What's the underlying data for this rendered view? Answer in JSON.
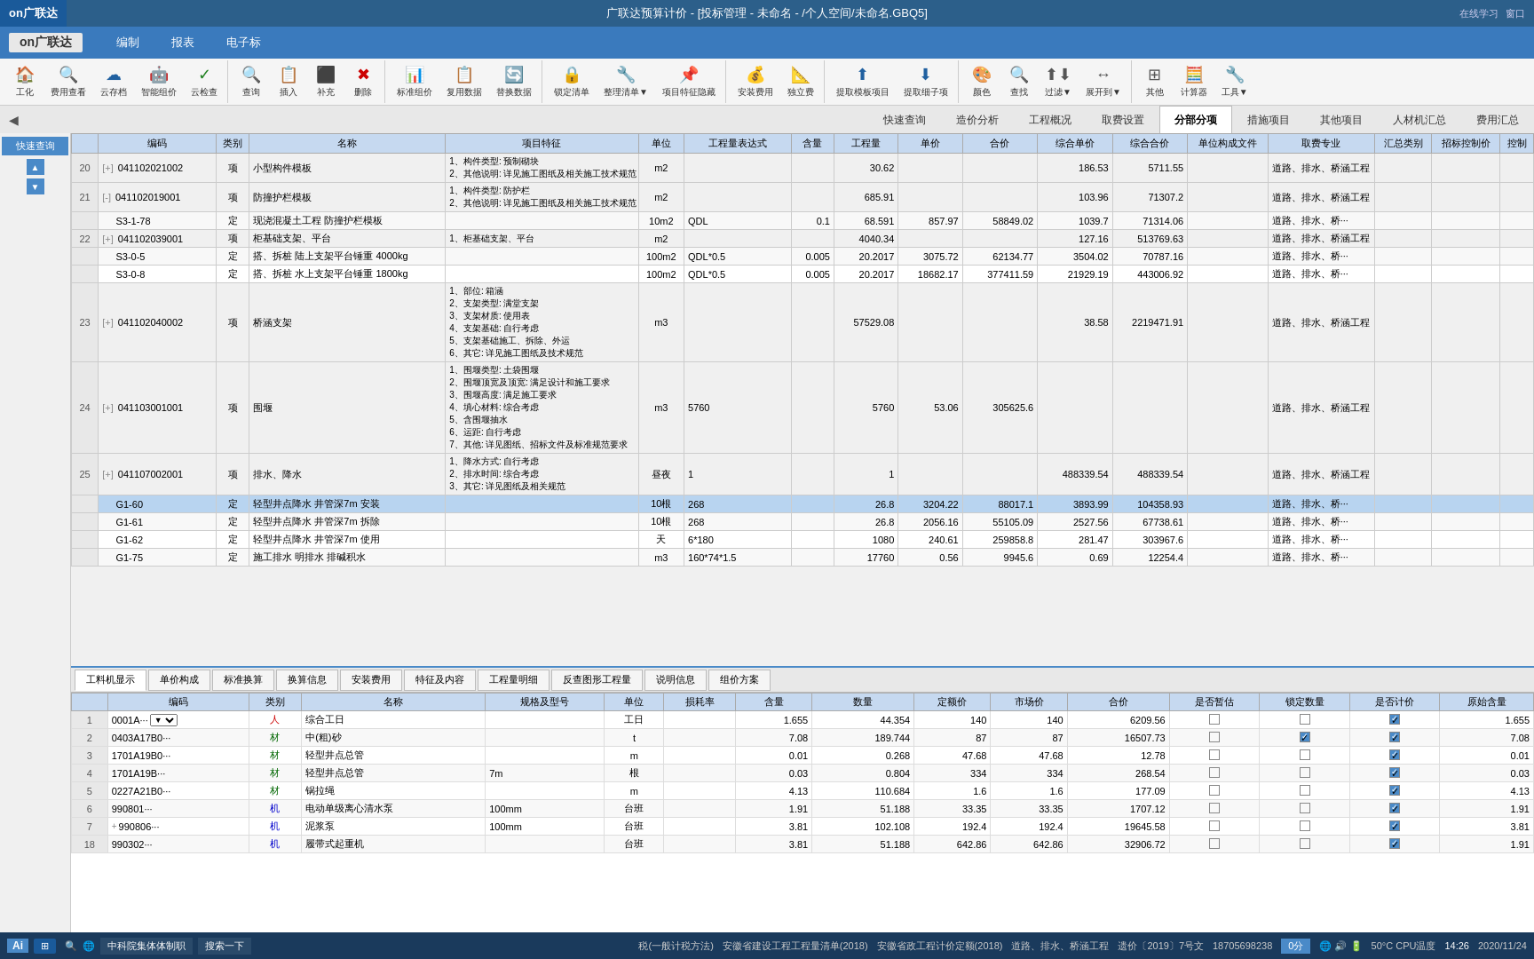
{
  "window": {
    "title": "广联达预算计价 - [投标管理 - 未命名 - /个人空间/未命名.GBQ5]"
  },
  "menubar": {
    "logo": "on广联达",
    "items": [
      "编制",
      "报表",
      "电子标"
    ],
    "right": [
      "在线学习",
      "窗口"
    ]
  },
  "toolbar": {
    "groups": [
      {
        "buttons": [
          {
            "icon": "🏠",
            "label": "工化"
          },
          {
            "icon": "🔍",
            "label": "费用查看"
          },
          {
            "icon": "☁",
            "label": "云存档"
          },
          {
            "icon": "🤖",
            "label": "智能组价"
          },
          {
            "icon": "✓",
            "label": "云检查"
          }
        ]
      },
      {
        "buttons": [
          {
            "icon": "🔍",
            "label": "查询"
          },
          {
            "icon": "📋",
            "label": "插入"
          },
          {
            "icon": "⬛",
            "label": "补充"
          },
          {
            "icon": "❌",
            "label": "删除"
          }
        ]
      },
      {
        "buttons": [
          {
            "icon": "📊",
            "label": "标准组价"
          },
          {
            "icon": "📋",
            "label": "复用数据"
          },
          {
            "icon": "🔄",
            "label": "替换数据"
          }
        ]
      },
      {
        "buttons": [
          {
            "icon": "🔒",
            "label": "锁定清单"
          },
          {
            "icon": "🔧",
            "label": "整理清单"
          },
          {
            "icon": "📌",
            "label": "项目特征隐藏"
          }
        ]
      },
      {
        "buttons": [
          {
            "icon": "💰",
            "label": "安装费用"
          },
          {
            "icon": "📐",
            "label": "独立费"
          }
        ]
      },
      {
        "buttons": [
          {
            "icon": "⬆",
            "label": "提取模板项目"
          },
          {
            "icon": "⬇",
            "label": "提取细子项"
          }
        ]
      },
      {
        "buttons": [
          {
            "icon": "🎨",
            "label": "颜色"
          },
          {
            "icon": "🔍",
            "label": "查找"
          },
          {
            "icon": "⬆⬇",
            "label": "过滤"
          },
          {
            "icon": "↔",
            "label": "展开到"
          }
        ]
      },
      {
        "buttons": [
          {
            "icon": "⊞",
            "label": "其他"
          },
          {
            "icon": "🧮",
            "label": "计算器"
          },
          {
            "icon": "🔧",
            "label": "工具"
          }
        ]
      }
    ]
  },
  "tabs": {
    "items": [
      "快速查询",
      "造价分析",
      "工程概况",
      "取费设置",
      "分部分项",
      "措施项目",
      "其他项目",
      "人材机汇总",
      "费用汇总"
    ],
    "active": "分部分项"
  },
  "table": {
    "headers": [
      "编码",
      "类别",
      "名称",
      "项目特征",
      "单位",
      "工程量表达式",
      "含量",
      "工程量",
      "单价",
      "合价",
      "综合单价",
      "综合合价",
      "单位构成文件",
      "取费专业",
      "汇总类别",
      "招标控制价",
      "控制"
    ],
    "rows": [
      {
        "num": "20",
        "code": "041102021002",
        "expand": "+",
        "type": "项",
        "name": "小型构件模板",
        "features": "1、构件类型: 预制砌块\n2、其他说明: 详见施工图纸及相关施工技术规范",
        "unit": "m2",
        "expr": "",
        "qty_ratio": "",
        "work": "30.62",
        "unit_price": "",
        "total": "",
        "comp_unit": "186.53",
        "comp_total": "5711.55",
        "file": "",
        "spec": "道路、排水、桥涵工程",
        "spec2": "道路、排水、桥涵工程",
        "class": "",
        "ctrl": ""
      },
      {
        "num": "21",
        "code": "041102019001",
        "expand": "-",
        "type": "项",
        "name": "防撞护栏模板",
        "features": "1、构件类型: 防护栏\n2、其他说明: 详见施工图纸及相关施工技术规范",
        "unit": "m2",
        "expr": "",
        "qty_ratio": "",
        "work": "685.91",
        "unit_price": "",
        "total": "",
        "comp_unit": "103.96",
        "comp_total": "71307.2",
        "file": "",
        "spec": "道路、排水、桥涵工程",
        "spec2": "道路、排水、桥涵工程",
        "class": "",
        "ctrl": ""
      },
      {
        "num": "",
        "code": "S3-1-78",
        "expand": "",
        "type": "定",
        "name": "现浇混凝土工程 防撞护栏模板",
        "features": "",
        "unit": "10m2",
        "expr": "QDL",
        "qty_ratio": "0.1",
        "work": "68.591",
        "unit_price": "857.97",
        "total": "58849.02",
        "comp_unit": "1039.7",
        "comp_total": "71314.06",
        "file": "",
        "spec": "道路、排水、桥···",
        "spec2": "道路、排水、桥···",
        "class": "",
        "ctrl": ""
      },
      {
        "num": "22",
        "code": "041102039001",
        "expand": "+",
        "type": "项",
        "name": "柜基础支架、平台",
        "features": "1、柜基础支架、平台",
        "unit": "m2",
        "expr": "",
        "qty_ratio": "",
        "work": "4040.34",
        "unit_price": "",
        "total": "",
        "comp_unit": "127.16",
        "comp_total": "513769.63",
        "file": "",
        "spec": "道路、排水、桥涵工程",
        "spec2": "道路、排水、桥涵工程",
        "class": "",
        "ctrl": ""
      },
      {
        "num": "",
        "code": "S3-0-5",
        "expand": "",
        "type": "定",
        "name": "搭、拆桩 陆上支架平台锤重 4000kg",
        "features": "",
        "unit": "100m2",
        "expr": "QDL*0.5",
        "qty_ratio": "0.005",
        "work": "20.2017",
        "unit_price": "3075.72",
        "total": "62134.77",
        "comp_unit": "3504.02",
        "comp_total": "70787.16",
        "file": "",
        "spec": "道路、排水、桥···",
        "spec2": "道路、排水、桥···",
        "class": "",
        "ctrl": ""
      },
      {
        "num": "",
        "code": "S3-0-8",
        "expand": "",
        "type": "定",
        "name": "搭、拆桩 水上支架平台锤重 1800kg",
        "features": "",
        "unit": "100m2",
        "expr": "QDL*0.5",
        "qty_ratio": "0.005",
        "work": "20.2017",
        "unit_price": "18682.17",
        "total": "377411.59",
        "comp_unit": "21929.19",
        "comp_total": "443006.92",
        "file": "",
        "spec": "道路、排水、桥···",
        "spec2": "道路、排水、桥···",
        "class": "",
        "ctrl": ""
      },
      {
        "num": "23",
        "code": "041102040002",
        "expand": "+",
        "type": "项",
        "name": "桥涵支架",
        "features": "1、部位: 箱涵\n2、支架类型: 满堂支架\n3、支架材质: 使用表\n4、支架基础: 自行考虑\n5、支架基础施工、拆除、外运\n6、其它: 详见施工图纸及技术规范",
        "unit": "m3",
        "expr": "",
        "qty_ratio": "",
        "work": "57529.08",
        "unit_price": "",
        "total": "",
        "comp_unit": "38.58",
        "comp_total": "2219471.91",
        "file": "",
        "spec": "道路、排水、桥涵工程",
        "spec2": "道路、排水、桥涵工程",
        "class": "",
        "ctrl": ""
      },
      {
        "num": "24",
        "code": "041103001001",
        "expand": "+",
        "type": "项",
        "name": "围堰",
        "features": "1、围堰类型: 土袋围堰\n2、围堰顶宽及顶宽: 满足设计和施工要求\n3、围堰高度: 满足施工要求\n4、填心材料: 综合考虑\n5、含围堰抽水\n6、运距: 自行考虑\n7、其他: 详见图纸、招标文件及标准规范要求",
        "unit": "m3",
        "expr": "5760",
        "qty_ratio": "",
        "work": "5760",
        "unit_price": "53.06",
        "total": "305625.6",
        "comp_unit": "",
        "comp_total": "",
        "file": "",
        "spec": "道路、排水、桥涵工程",
        "spec2": "道路、排水、桥涵工程",
        "class": "",
        "ctrl": ""
      },
      {
        "num": "25",
        "code": "041107002001",
        "expand": "+",
        "type": "项",
        "name": "排水、降水",
        "features": "1、降水方式: 自行考虑\n2、排水时间: 综合考虑\n3、其它: 详见图纸及相关规范",
        "unit": "昼夜",
        "expr": "1",
        "qty_ratio": "",
        "work": "1",
        "unit_price": "",
        "total": "",
        "comp_unit": "488339.54",
        "comp_total": "488339.54",
        "file": "",
        "spec": "道路、排水、桥涵工程",
        "spec2": "道路、排水、桥涵工程",
        "class": "",
        "ctrl": ""
      },
      {
        "num": "",
        "code": "G1-60",
        "expand": "",
        "type": "定",
        "name": "轻型井点降水 井管深7m 安装",
        "features": "",
        "unit": "10根",
        "expr": "268",
        "qty_ratio": "",
        "work": "26.8",
        "unit_price": "3204.22",
        "total": "88017.1",
        "comp_unit": "3893.99",
        "comp_total": "104358.93",
        "file": "",
        "spec": "道路、排水、桥···",
        "spec2": "道路、排水、桥···",
        "class": "",
        "ctrl": "",
        "selected": true
      },
      {
        "num": "",
        "code": "G1-61",
        "expand": "",
        "type": "定",
        "name": "轻型井点降水 井管深7m 拆除",
        "features": "",
        "unit": "10根",
        "expr": "268",
        "qty_ratio": "",
        "work": "26.8",
        "unit_price": "2056.16",
        "total": "55105.09",
        "comp_unit": "2527.56",
        "comp_total": "67738.61",
        "file": "",
        "spec": "道路、排水、桥···",
        "spec2": "道路、排水、桥···",
        "class": "",
        "ctrl": ""
      },
      {
        "num": "",
        "code": "G1-62",
        "expand": "",
        "type": "定",
        "name": "轻型井点降水 井管深7m 使用",
        "features": "",
        "unit": "天",
        "expr": "6*180",
        "qty_ratio": "",
        "work": "1080",
        "unit_price": "240.61",
        "total": "259858.8",
        "comp_unit": "281.47",
        "comp_total": "303967.6",
        "file": "",
        "spec": "道路、排水、桥···",
        "spec2": "道路、排水、桥···",
        "class": "",
        "ctrl": ""
      },
      {
        "num": "",
        "code": "G1-75",
        "expand": "",
        "type": "定",
        "name": "施工排水 明排水 排碱积水",
        "features": "",
        "unit": "m3",
        "expr": "160*74*1.5",
        "qty_ratio": "",
        "work": "17760",
        "unit_price": "0.56",
        "total": "9945.6",
        "comp_unit": "0.69",
        "comp_total": "12254.4",
        "file": "",
        "spec": "道路、排水、桥···",
        "spec2": "道路、排水、桥···",
        "class": "",
        "ctrl": ""
      }
    ]
  },
  "bottom_tabs": [
    "工料机显示",
    "单价构成",
    "标准换算",
    "换算信息",
    "安装费用",
    "特征及内容",
    "工程量明细",
    "反查图形工程量",
    "说明信息",
    "组价方案"
  ],
  "bottom_table": {
    "headers": [
      "编码",
      "类别",
      "名称",
      "规格及型号",
      "单位",
      "损耗率",
      "含量",
      "数量",
      "定额价",
      "市场价",
      "合价",
      "是否暂估",
      "锁定数量",
      "是否计价",
      "原始含量"
    ],
    "rows": [
      {
        "num": "1",
        "code": "0001A···",
        "type": "人",
        "name": "综合工日",
        "spec": "",
        "unit": "工日",
        "loss": "",
        "qty": "1.655",
        "count": "44.354",
        "fixed": "140",
        "market": "140",
        "total": "6209.56",
        "is_temp": false,
        "lock": false,
        "is_price": true,
        "orig": "1.655"
      },
      {
        "num": "2",
        "code": "0403A17B0···",
        "type": "材",
        "name": "中(粗)砂",
        "spec": "",
        "unit": "t",
        "loss": "",
        "qty": "7.08",
        "count": "189.744",
        "fixed": "87",
        "market": "87",
        "total": "16507.73",
        "is_temp": false,
        "lock": true,
        "is_price": true,
        "orig": "7.08"
      },
      {
        "num": "3",
        "code": "1701A19B0···",
        "type": "材",
        "name": "轻型井点总管",
        "spec": "",
        "unit": "m",
        "loss": "",
        "qty": "0.01",
        "count": "0.268",
        "fixed": "47.68",
        "market": "47.68",
        "total": "12.78",
        "is_temp": false,
        "lock": false,
        "is_price": true,
        "orig": "0.01"
      },
      {
        "num": "4",
        "code": "1701A19B···",
        "type": "材",
        "name": "轻型井点总管",
        "spec": "7m",
        "unit": "根",
        "loss": "",
        "qty": "0.03",
        "count": "0.804",
        "fixed": "334",
        "market": "334",
        "total": "268.54",
        "is_temp": false,
        "lock": false,
        "is_price": true,
        "orig": "0.03"
      },
      {
        "num": "5",
        "code": "0227A21B0···",
        "type": "材",
        "name": "锅拉绳",
        "spec": "",
        "unit": "m",
        "loss": "",
        "qty": "4.13",
        "count": "110.684",
        "fixed": "1.6",
        "market": "1.6",
        "total": "177.09",
        "is_temp": false,
        "lock": false,
        "is_price": true,
        "orig": "4.13"
      },
      {
        "num": "6",
        "code": "990801···",
        "type": "机",
        "name": "电动单级离心清水泵",
        "spec": "100mm",
        "unit": "台班",
        "loss": "",
        "qty": "1.91",
        "count": "51.188",
        "fixed": "33.35",
        "market": "33.35",
        "total": "1707.12",
        "is_temp": false,
        "lock": false,
        "is_price": true,
        "orig": "1.91"
      },
      {
        "num": "7",
        "code": "990806···",
        "type": "机",
        "name": "泥浆泵",
        "spec": "100mm",
        "unit": "台班",
        "loss": "",
        "qty": "3.81",
        "count": "102.108",
        "fixed": "192.4",
        "market": "192.4",
        "total": "19645.58",
        "is_temp": false,
        "lock": false,
        "is_price": true,
        "orig": "3.81"
      },
      {
        "num": "18",
        "code": "990302···",
        "type": "机",
        "name": "履带式起重机",
        "spec": "",
        "unit": "台班",
        "loss": "",
        "qty": "3.81",
        "count": "51.188",
        "fixed": "642.86",
        "market": "642.86",
        "total": "32906.72",
        "is_temp": false,
        "lock": false,
        "is_price": true,
        "orig": "1.91"
      }
    ]
  },
  "status_bar": {
    "method": "税(一般计税方法)",
    "quota": "安徽省建设工程工程量清单(2018)",
    "price": "安徽省政工程计价定额(2018)",
    "profession": "道路、排水、桥涵工程",
    "doc_num": "遗价〔2019〕7号文",
    "phone": "18705698238",
    "score": "0分"
  },
  "taskbar": {
    "items": [
      "中科院集体体制职",
      "搜索一下"
    ],
    "ai_label": "Ai",
    "time": "14:26",
    "date": "2020/11/24",
    "cpu_temp": "50°C CPU温度",
    "system_icons": [
      "🌐",
      "🔔",
      "💬",
      "🌙",
      "📁",
      "💻",
      "📺",
      "🔧"
    ]
  }
}
